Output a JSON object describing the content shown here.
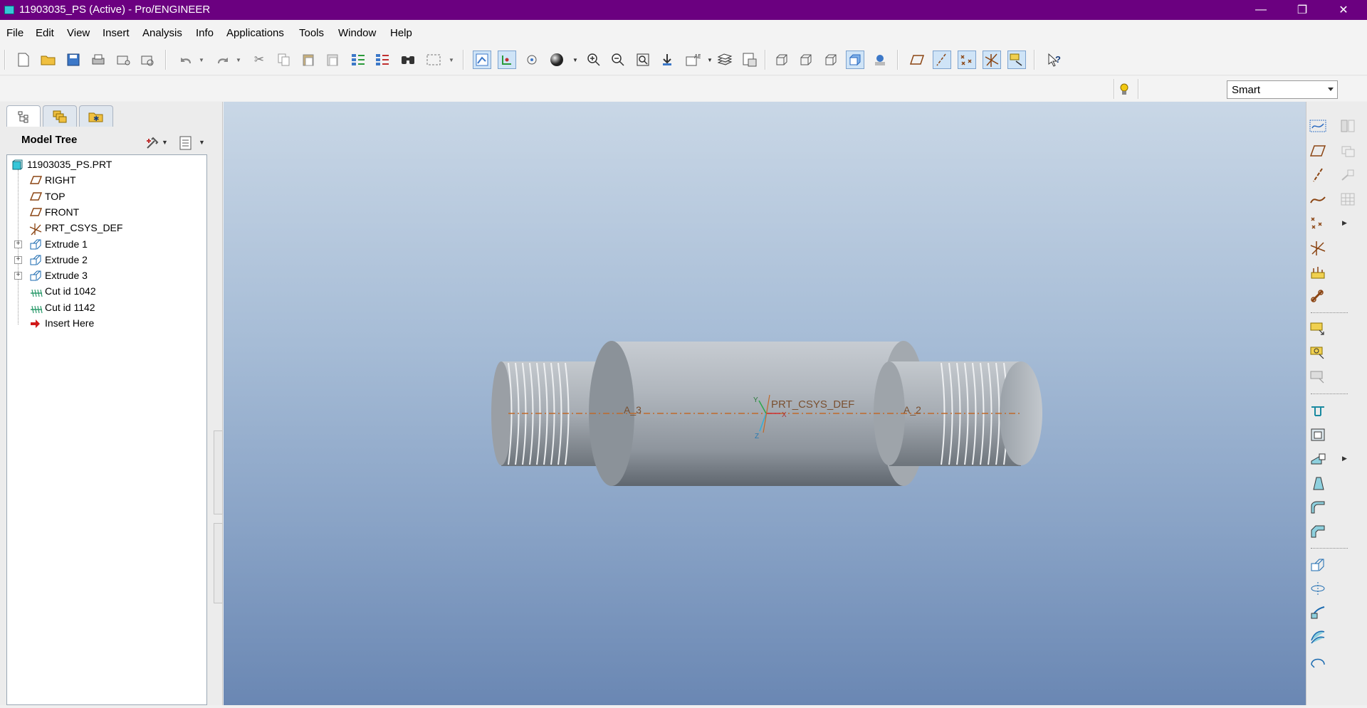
{
  "window": {
    "title": "11903035_PS (Active) - Pro/ENGINEER",
    "controls": [
      "minimize",
      "restore",
      "close"
    ]
  },
  "menu": [
    "File",
    "Edit",
    "View",
    "Insert",
    "Analysis",
    "Info",
    "Applications",
    "Tools",
    "Window",
    "Help"
  ],
  "filter": {
    "selected": "Smart"
  },
  "left_panel": {
    "tabs": [
      "model-tree-tab",
      "layers-tab",
      "favorites-tab"
    ],
    "title": "Model Tree",
    "tree": [
      {
        "label": "11903035_PS.PRT",
        "icon": "part-icon",
        "expandable": false
      },
      {
        "label": "RIGHT",
        "icon": "datum-plane-icon",
        "expandable": false
      },
      {
        "label": "TOP",
        "icon": "datum-plane-icon",
        "expandable": false
      },
      {
        "label": "FRONT",
        "icon": "datum-plane-icon",
        "expandable": false
      },
      {
        "label": "PRT_CSYS_DEF",
        "icon": "csys-icon",
        "expandable": false
      },
      {
        "label": "Extrude 1",
        "icon": "extrude-icon",
        "expandable": true
      },
      {
        "label": "Extrude 2",
        "icon": "extrude-icon",
        "expandable": true
      },
      {
        "label": "Extrude 3",
        "icon": "extrude-icon",
        "expandable": true
      },
      {
        "label": "Cut id 1042",
        "icon": "cosmetic-thread-icon",
        "expandable": false
      },
      {
        "label": "Cut id 1142",
        "icon": "cosmetic-thread-icon",
        "expandable": false
      },
      {
        "label": "Insert Here",
        "icon": "insert-arrow-icon",
        "expandable": false
      }
    ]
  },
  "viewport": {
    "axis_labels": [
      "A_3",
      "A_2"
    ],
    "csys_label": "PRT_CSYS_DEF",
    "csys_axes": [
      "Y",
      "X",
      "Z"
    ]
  },
  "colors": {
    "titlebar": "#6b0080",
    "viewport_top": "#c9d7e6",
    "viewport_bottom": "#6a87b3",
    "axis_line": "#c06a2a",
    "datum_plane": "#8b4513"
  }
}
